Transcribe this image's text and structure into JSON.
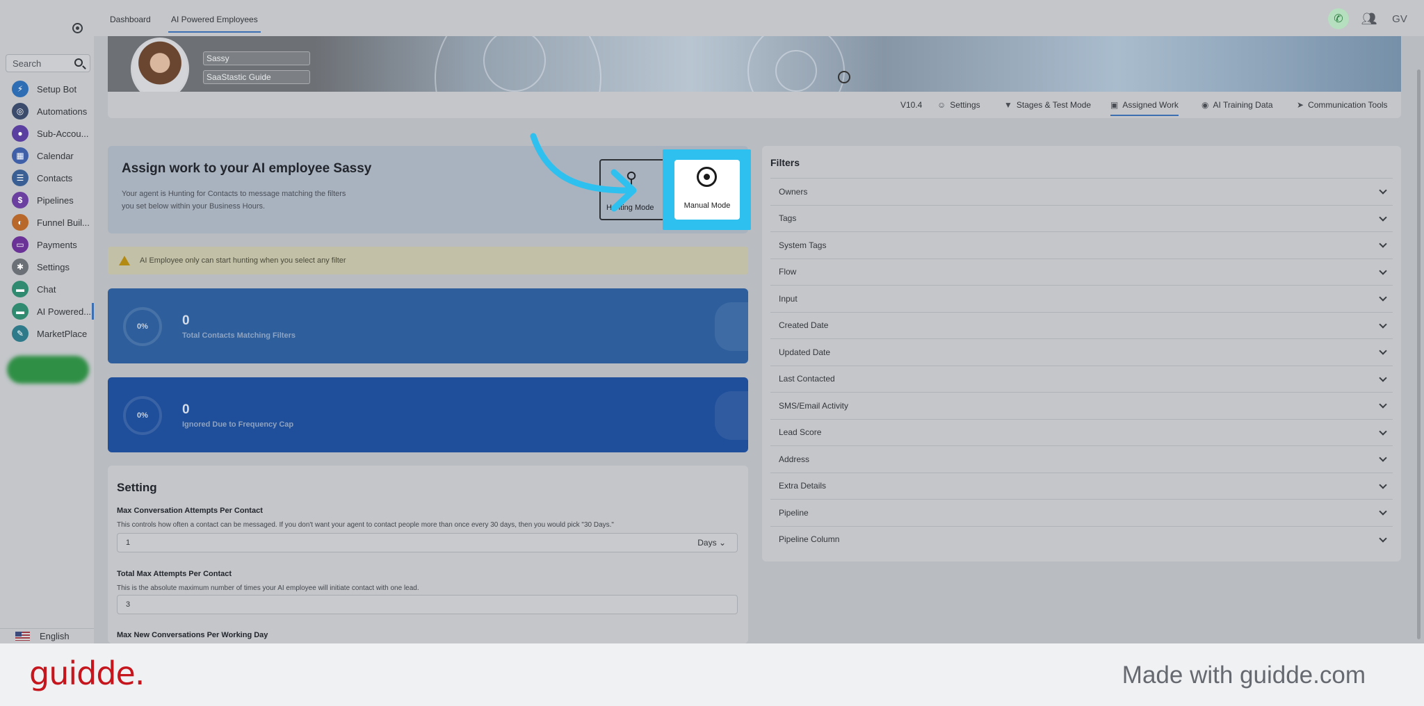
{
  "sidebar": {
    "search_placeholder": "Search",
    "items": [
      {
        "label": "Setup Bot",
        "icon": "bolt-icon",
        "color": "#2d6db3",
        "glyph": "⚡"
      },
      {
        "label": "Automations",
        "icon": "automation-icon",
        "color": "#3a4b6b",
        "glyph": "◎"
      },
      {
        "label": "Sub-Accou...",
        "icon": "sub-account-icon",
        "color": "#5b3fa0",
        "glyph": "●"
      },
      {
        "label": "Calendar",
        "icon": "calendar-icon",
        "color": "#3f5fa8",
        "glyph": "▦"
      },
      {
        "label": "Contacts",
        "icon": "contacts-icon",
        "color": "#3a5f94",
        "glyph": "☰"
      },
      {
        "label": "Pipelines",
        "icon": "pipelines-icon",
        "color": "#6a3fa0",
        "glyph": "$"
      },
      {
        "label": "Funnel Buil...",
        "icon": "funnel-icon",
        "color": "#b8682a",
        "glyph": "◐"
      },
      {
        "label": "Payments",
        "icon": "payments-icon",
        "color": "#6a3296",
        "glyph": "▭"
      },
      {
        "label": "Settings",
        "icon": "settings-gear-icon",
        "color": "#6b6f76",
        "glyph": "✱"
      },
      {
        "label": "Chat",
        "icon": "chat-icon",
        "color": "#2f8a70",
        "glyph": "▬"
      },
      {
        "label": "AI Powered...",
        "icon": "ai-chat-icon",
        "color": "#2f8a70",
        "glyph": "▬",
        "active": true
      },
      {
        "label": "MarketPlace",
        "icon": "marketplace-icon",
        "color": "#2f7a8a",
        "glyph": "✎"
      }
    ],
    "language": "English"
  },
  "topbar": {
    "tabs": [
      "Dashboard",
      "AI Powered Employees"
    ],
    "avatar_initials": "GV"
  },
  "profile": {
    "name": "Sassy",
    "company": "SaaStastic Guide"
  },
  "subtabs": [
    {
      "label": "V10.4",
      "icon": ""
    },
    {
      "label": "Settings",
      "icon": "☺"
    },
    {
      "label": "Stages & Test Mode",
      "icon": "▼"
    },
    {
      "label": "Assigned Work",
      "icon": "▣",
      "active": true
    },
    {
      "label": "AI Training Data",
      "icon": "◉"
    },
    {
      "label": "Communication Tools",
      "icon": "➤"
    }
  ],
  "assign": {
    "title": "Assign work to your AI employee Sassy",
    "description": "Your agent is Hunting for Contacts to message matching the filters you set below within your Business Hours.",
    "hunting_label": "Hunting Mode",
    "manual_label": "Manual Mode"
  },
  "warning": "AI Employee only can start hunting when you select any filter",
  "stats": [
    {
      "percent": "0%",
      "value": "0",
      "caption": "Total Contacts Matching Filters"
    },
    {
      "percent": "0%",
      "value": "0",
      "caption": "Ignored Due to Frequency Cap"
    }
  ],
  "settings": {
    "title": "Setting",
    "fields": [
      {
        "label": "Max Conversation Attempts Per Contact",
        "help": "This controls how often a contact can be messaged. If you don't want your agent to contact people more than once every 30 days, then you would pick \"30 Days.\"",
        "value": "1",
        "unit": "Days"
      },
      {
        "label": "Total Max Attempts Per Contact",
        "help": "This is the absolute maximum number of times your AI employee will initiate contact with one lead.",
        "value": "3"
      },
      {
        "label": "Max New Conversations Per Working Day"
      }
    ]
  },
  "filters": {
    "title": "Filters",
    "items": [
      "Owners",
      "Tags",
      "System Tags",
      "Flow",
      "Input",
      "Created Date",
      "Updated Date",
      "Last Contacted",
      "SMS/Email Activity",
      "Lead Score",
      "Address",
      "Extra Details",
      "Pipeline",
      "Pipeline Column"
    ]
  },
  "footer": {
    "logo": "guidde.",
    "made_with": "Made with guidde.com"
  }
}
